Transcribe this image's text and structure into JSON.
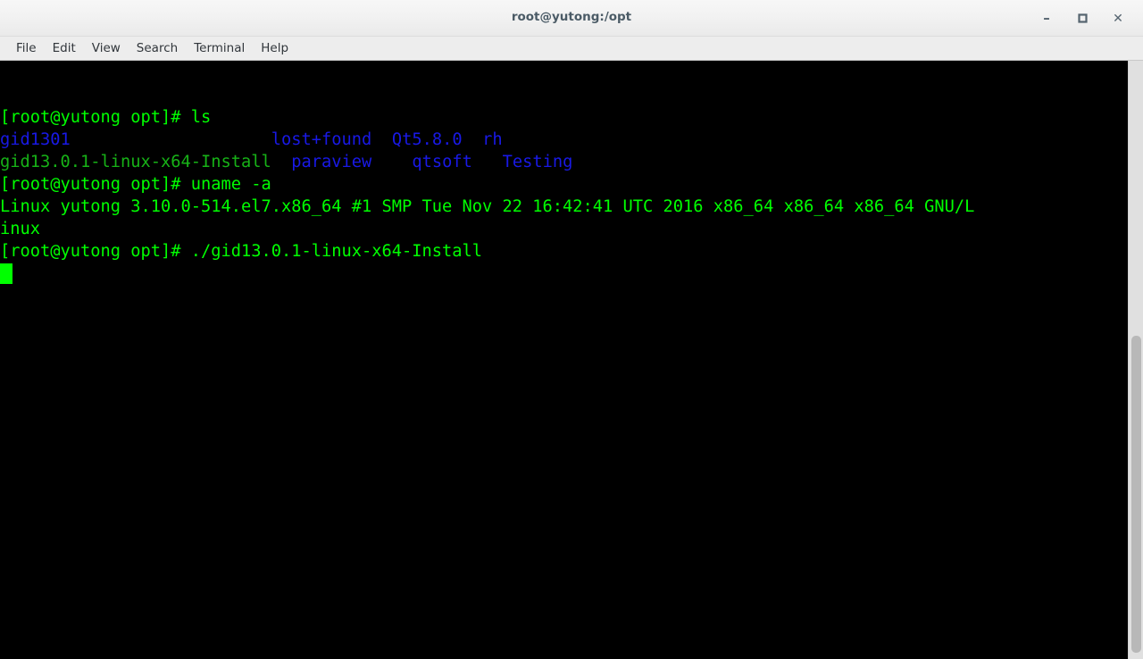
{
  "window": {
    "title": "root@yutong:/opt",
    "controls": [
      {
        "name": "minimize",
        "glyph": "–"
      },
      {
        "name": "maximize",
        "glyph": "□"
      },
      {
        "name": "close",
        "glyph": "✕"
      }
    ]
  },
  "menubar": {
    "items": [
      {
        "label": "File"
      },
      {
        "label": "Edit"
      },
      {
        "label": "View"
      },
      {
        "label": "Search"
      },
      {
        "label": "Terminal"
      },
      {
        "label": "Help"
      }
    ]
  },
  "terminal": {
    "prompt": "[root@yutong opt]# ",
    "colors": {
      "background": "#000000",
      "foreground": "#00ff00",
      "directory": "#1919e6",
      "executable": "#17b217",
      "cursor": "#00ff00"
    },
    "lines": [
      {
        "index": 0,
        "segments": [
          {
            "text": "[root@yutong opt]# ls",
            "color": "bright-green"
          }
        ]
      },
      {
        "index": 1,
        "segments": [
          {
            "text": "gid1301",
            "color": "blue"
          },
          {
            "text": "                    ",
            "color": "bright-green"
          },
          {
            "text": "lost+found",
            "color": "blue"
          },
          {
            "text": "  ",
            "color": "bright-green"
          },
          {
            "text": "Qt5.8.0",
            "color": "blue"
          },
          {
            "text": "  ",
            "color": "bright-green"
          },
          {
            "text": "rh",
            "color": "blue"
          }
        ]
      },
      {
        "index": 2,
        "segments": [
          {
            "text": "gid13.0.1-linux-x64-Install",
            "color": "green"
          },
          {
            "text": "  ",
            "color": "bright-green"
          },
          {
            "text": "paraview",
            "color": "blue"
          },
          {
            "text": "    ",
            "color": "bright-green"
          },
          {
            "text": "qtsoft",
            "color": "blue"
          },
          {
            "text": "   ",
            "color": "bright-green"
          },
          {
            "text": "Testing",
            "color": "blue"
          }
        ]
      },
      {
        "index": 3,
        "segments": [
          {
            "text": "[root@yutong opt]# uname -a",
            "color": "bright-green"
          }
        ]
      },
      {
        "index": 4,
        "segments": [
          {
            "text": "Linux yutong 3.10.0-514.el7.x86_64 #1 SMP Tue Nov 22 16:42:41 UTC 2016 x86_64 x86_64 x86_64 GNU/L",
            "color": "bright-green"
          }
        ]
      },
      {
        "index": 5,
        "segments": [
          {
            "text": "inux",
            "color": "bright-green"
          }
        ]
      },
      {
        "index": 6,
        "segments": [
          {
            "text": "[root@yutong opt]# ./gid13.0.1-linux-x64-Install",
            "color": "bright-green"
          }
        ]
      }
    ],
    "cursor": {
      "row": 7,
      "column": 0,
      "shape": "block"
    }
  },
  "scrollbar": {
    "orientation": "vertical",
    "thumb_top_pct": 46,
    "thumb_height_pct": 53
  }
}
